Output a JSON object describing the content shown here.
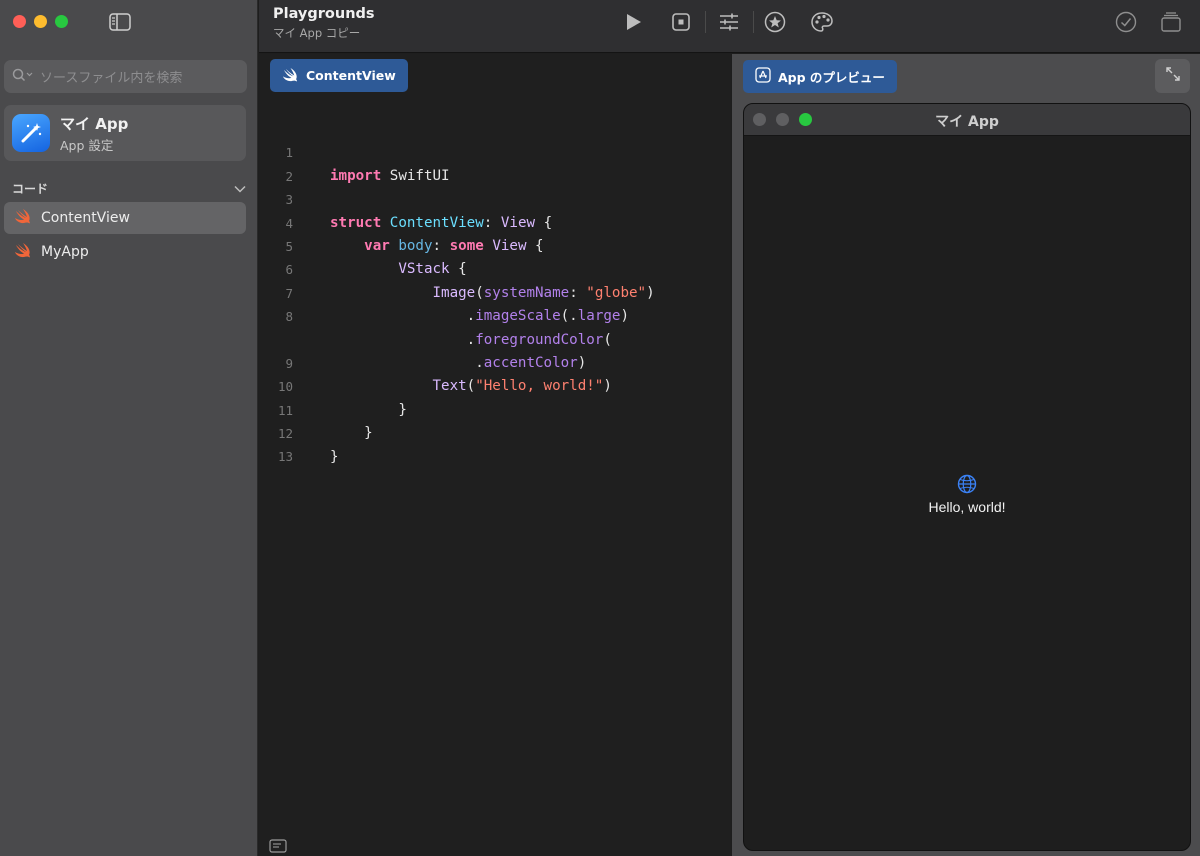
{
  "sidebar": {
    "search_placeholder": "ソースファイル内を検索",
    "app": {
      "name": "マイ App",
      "subtitle": "App 設定"
    },
    "section_label": "コード",
    "files": [
      {
        "label": "ContentView",
        "selected": true
      },
      {
        "label": "MyApp",
        "selected": false
      }
    ]
  },
  "toolbar": {
    "title": "Playgrounds",
    "subtitle": "マイ App コピー",
    "buttons": [
      "play-icon",
      "stop-icon",
      "sliders-icon",
      "star-icon",
      "palette-icon",
      "checkmark-icon",
      "stack-icon"
    ]
  },
  "editor": {
    "tab_label": "ContentView",
    "line_numbers": [
      "1",
      "2",
      "3",
      "4",
      "5",
      "6",
      "7",
      "8",
      "",
      "9",
      "10",
      "11",
      "12",
      "13"
    ],
    "code": {
      "l1_kw": "import",
      "l1_rest": " SwiftUI",
      "l3_kw": "struct",
      "l3_name": "ContentView",
      "l3_colon": ": ",
      "l3_type": "View",
      "l3_brace": " {",
      "l4_kw": "var",
      "l4_prop": "body",
      "l4_colon": ": ",
      "l4_kw2": "some",
      "l4_type": "View",
      "l4_brace": " {",
      "l5_type": "VStack",
      "l5_brace": " {",
      "l6_type": "Image",
      "l6_open": "(",
      "l6_param": "systemName",
      "l6_colon": ": ",
      "l6_str": "\"globe\"",
      "l6_close": ")",
      "l7_dot": ".",
      "l7_fn": "imageScale",
      "l7_open": "(.",
      "l7_arg": "large",
      "l7_close": ")",
      "l8_dot": ".",
      "l8_fn": "foregroundColor",
      "l8_open": "(",
      "l8b_dot": ".",
      "l8b_arg": "accentColor",
      "l8b_close": ")",
      "l9_type": "Text",
      "l9_open": "(",
      "l9_str": "\"Hello, world!\"",
      "l9_close": ")",
      "l10": "}",
      "l11": "}",
      "l12": "}"
    }
  },
  "preview": {
    "button_label": "App のプレビュー",
    "window_title": "マイ App",
    "text": "Hello, world!",
    "accent_color": "#3b82f6"
  }
}
